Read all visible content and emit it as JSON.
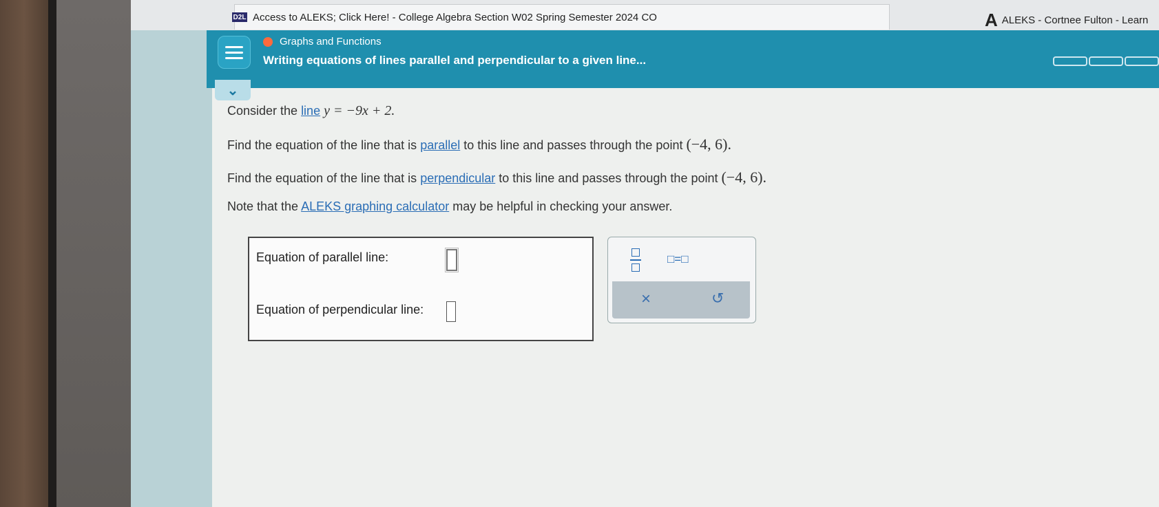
{
  "browser": {
    "tab_title": "Access to ALEKS; Click Here! - College Algebra Section W02 Spring Semester 2024 CO",
    "tab_favicon": "D2L",
    "right_logo": "A",
    "right_title": "ALEKS - Cortnee Fulton - Learn"
  },
  "header": {
    "topic": "Graphs and Functions",
    "lesson_title": "Writing equations of lines parallel and perpendicular to a given line...",
    "topic_dot_color": "#ff6a3d",
    "background_color": "#1f8fae"
  },
  "problem": {
    "p1_prefix": "Consider the ",
    "p1_link": "line",
    "p1_equation": "y = −9x + 2.",
    "p2_prefix": "Find the equation of the line that is ",
    "p2_link": "parallel",
    "p2_suffix": " to this line and passes through the point ",
    "p2_point": "(−4,  6).",
    "p3_prefix": "Find the equation of the line that is ",
    "p3_link": "perpendicular",
    "p3_suffix": " to this line and passes through the point ",
    "p3_point": "(−4,  6).",
    "p4_prefix": "Note that the ",
    "p4_link": "ALEKS graphing calculator",
    "p4_suffix": " may be helpful in checking your answer."
  },
  "answers": {
    "parallel_label": "Equation of parallel line:",
    "parallel_value": "",
    "perpendicular_label": "Equation of perpendicular line:",
    "perpendicular_value": ""
  },
  "palette": {
    "equals_label": "□=□",
    "clear_label": "×",
    "undo_label": "↺"
  }
}
